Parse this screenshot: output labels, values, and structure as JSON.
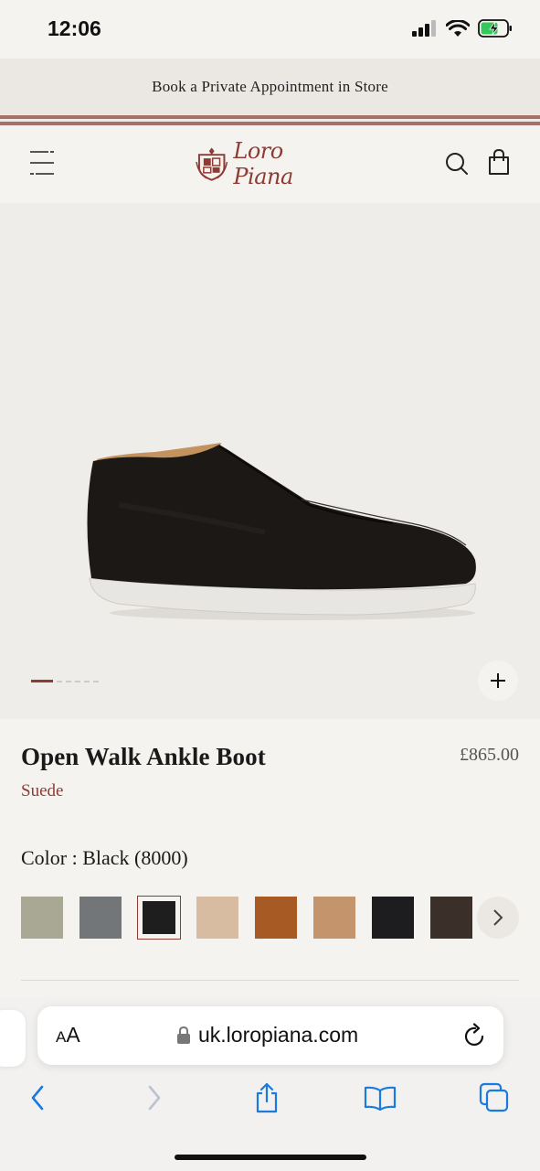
{
  "status_bar": {
    "time": "12:06"
  },
  "banner": {
    "text": "Book a Private Appointment in Store"
  },
  "header": {
    "logo_text": "Loro Piana"
  },
  "gallery": {
    "image_count": 6,
    "current_index": 1
  },
  "product": {
    "title": "Open Walk Ankle Boot",
    "price": "£865.00",
    "material": "Suede",
    "color_label": "Color : Black (8000)"
  },
  "swatches": [
    {
      "color": "#a8a895",
      "selected": false
    },
    {
      "color": "#737679",
      "selected": false
    },
    {
      "color": "#1e1e1e",
      "selected": true
    },
    {
      "color": "#d8bca2",
      "selected": false
    },
    {
      "color": "#a85a24",
      "selected": false
    },
    {
      "color": "#c4956d",
      "selected": false
    },
    {
      "color": "#1d1d1f",
      "selected": false
    },
    {
      "color": "#3b3029",
      "selected": false
    }
  ],
  "browser": {
    "aa_small": "A",
    "aa_big": "A",
    "url": "uk.loropiana.com"
  },
  "colors": {
    "brand": "#8d3b33",
    "ios_blue": "#1a7ae0"
  }
}
